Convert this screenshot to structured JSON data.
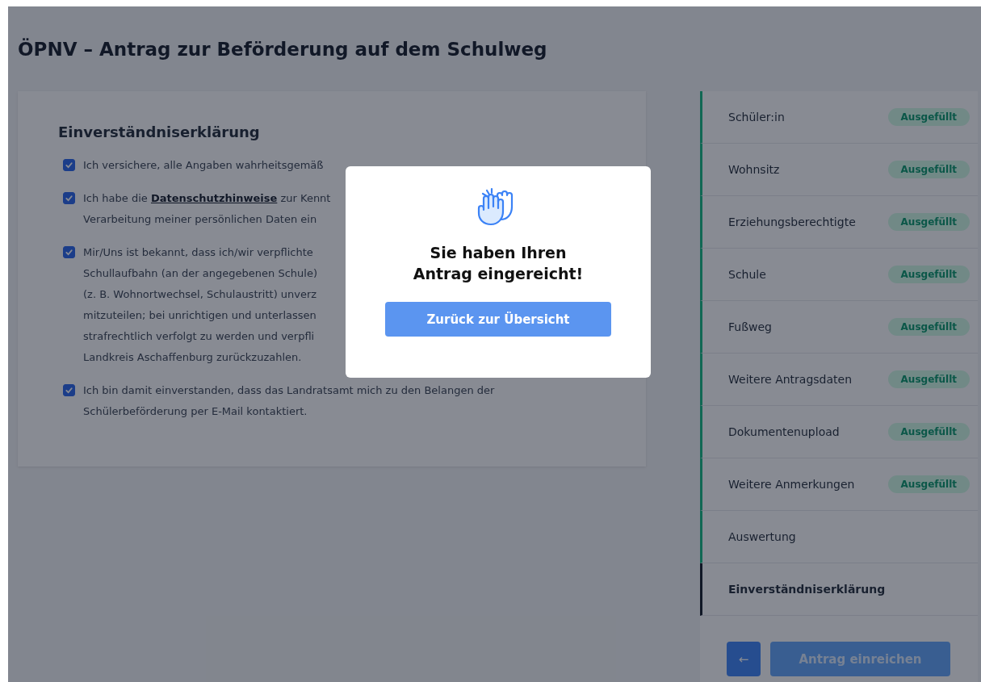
{
  "page_title": "ÖPNV – Antrag zur Beförderung auf dem Schulweg",
  "consent_card": {
    "heading": "Einverständniserklärung",
    "items": [
      {
        "checked": true,
        "lines": [
          [
            {
              "kind": "text",
              "text": "Ich versichere, alle Angaben wahrheitsgemäß"
            }
          ]
        ]
      },
      {
        "checked": true,
        "lines": [
          [
            {
              "kind": "text",
              "text": "Ich habe die "
            },
            {
              "kind": "link",
              "text": "Datenschutzhinweise"
            },
            {
              "kind": "text",
              "text": " zur Kennt"
            }
          ],
          [
            {
              "kind": "text",
              "text": "Verarbeitung meiner persönlichen Daten ein"
            }
          ]
        ]
      },
      {
        "checked": true,
        "lines": [
          [
            {
              "kind": "text",
              "text": "Mir/Uns ist bekannt, dass ich/wir verpflichte"
            }
          ],
          [
            {
              "kind": "text",
              "text": "Schullaufbahn (an der angegebenen Schule)"
            }
          ],
          [
            {
              "kind": "text",
              "text": "(z. B. Wohnortwechsel, Schulaustritt) unverz"
            }
          ],
          [
            {
              "kind": "text",
              "text": "mitzuteilen; bei unrichtigen und unterlassen"
            }
          ],
          [
            {
              "kind": "text",
              "text": "strafrechtlich verfolgt zu werden und verpfli"
            }
          ],
          [
            {
              "kind": "text",
              "text": "Landkreis Aschaffenburg zurückzuzahlen."
            }
          ]
        ]
      },
      {
        "checked": true,
        "lines": [
          [
            {
              "kind": "text",
              "text": "Ich bin damit einverstanden, dass das Landratsamt mich zu den Belangen der"
            }
          ],
          [
            {
              "kind": "text",
              "text": "Schülerbeförderung per E-Mail kontaktiert."
            }
          ]
        ]
      }
    ]
  },
  "steps": [
    {
      "label": "Schüler:in",
      "badge": "Ausgefüllt",
      "selected": false
    },
    {
      "label": "Wohnsitz",
      "badge": "Ausgefüllt",
      "selected": false
    },
    {
      "label": "Erziehungsberechtigte",
      "badge": "Ausgefüllt",
      "selected": false
    },
    {
      "label": "Schule",
      "badge": "Ausgefüllt",
      "selected": false
    },
    {
      "label": "Fußweg",
      "badge": "Ausgefüllt",
      "selected": false
    },
    {
      "label": "Weitere Antragsdaten",
      "badge": "Ausgefüllt",
      "selected": false
    },
    {
      "label": "Dokumentenupload",
      "badge": "Ausgefüllt",
      "selected": false
    },
    {
      "label": "Weitere Anmerkungen",
      "badge": "Ausgefüllt",
      "selected": false
    },
    {
      "label": "Auswertung",
      "selected": false
    },
    {
      "label": "Einverständniserklärung",
      "selected": true
    }
  ],
  "back_button": "←",
  "submit_button": "Antrag einreichen",
  "dialog": {
    "message": "Sie haben Ihren Antrag eingereicht!",
    "button": "Zurück zur Übersicht"
  }
}
